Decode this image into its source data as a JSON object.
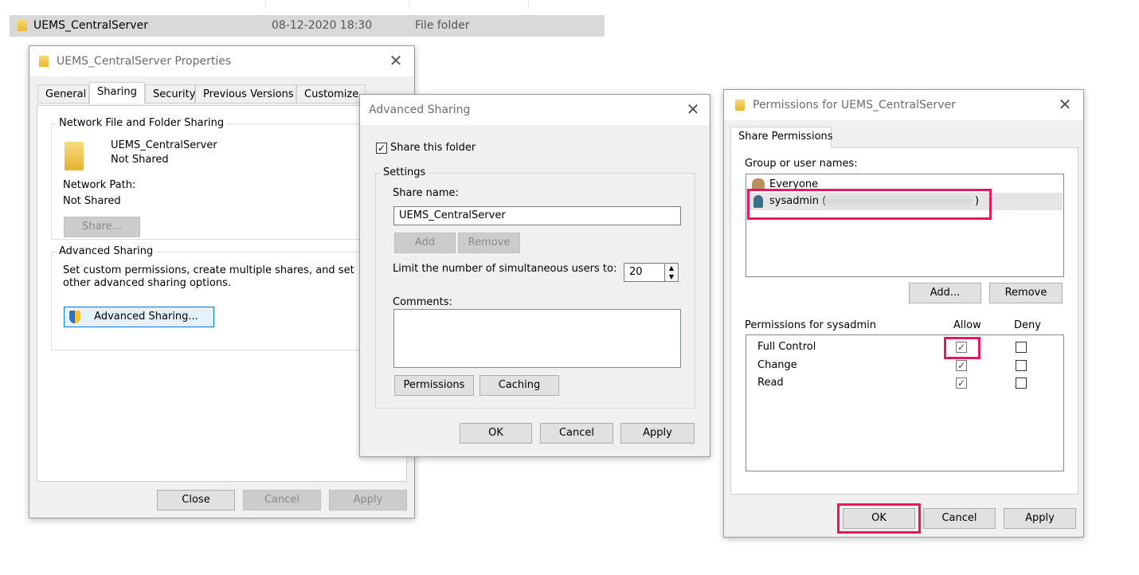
{
  "explorer": {
    "row": {
      "name": "UEMS_CentralServer",
      "date": "08-12-2020 18:30",
      "type": "File folder"
    }
  },
  "properties": {
    "title": "UEMS_CentralServer Properties",
    "close_glyph": "✕",
    "tabs": [
      {
        "label": "General"
      },
      {
        "label": "Sharing"
      },
      {
        "label": "Security"
      },
      {
        "label": "Previous Versions"
      },
      {
        "label": "Customize"
      }
    ],
    "network_group": {
      "legend": "Network File and Folder Sharing",
      "folder_name": "UEMS_CentralServer",
      "status": "Not Shared",
      "path_label": "Network Path:",
      "path_value": "Not Shared",
      "share_button": "Share..."
    },
    "advanced_group": {
      "legend": "Advanced Sharing",
      "description": "Set custom permissions, create multiple shares, and set other advanced sharing options.",
      "button": "Advanced Sharing..."
    },
    "buttons": {
      "close": "Close",
      "cancel": "Cancel",
      "apply": "Apply"
    }
  },
  "advanced_sharing": {
    "title": "Advanced Sharing",
    "close_glyph": "✕",
    "share_checkbox": {
      "label": "Share this folder",
      "checked": "✓"
    },
    "settings_legend": "Settings",
    "share_name_label": "Share name:",
    "share_name_value": "UEMS_CentralServer",
    "add_button": "Add",
    "remove_button": "Remove",
    "limit_label": "Limit the number of simultaneous users to:",
    "limit_value": "20",
    "comments_label": "Comments:",
    "permissions_button": "Permissions",
    "caching_button": "Caching",
    "buttons": {
      "ok": "OK",
      "cancel": "Cancel",
      "apply": "Apply"
    }
  },
  "permissions": {
    "title": "Permissions for UEMS_CentralServer",
    "close_glyph": "✕",
    "tab": "Share Permissions",
    "group_label": "Group or user names:",
    "users": [
      {
        "name": "Everyone"
      },
      {
        "name": "sysadmin (",
        "suffix": ")"
      }
    ],
    "add_button": "Add...",
    "remove_button": "Remove",
    "perm_label": "Permissions for sysadmin",
    "allow_header": "Allow",
    "deny_header": "Deny",
    "rows": [
      {
        "name": "Full Control",
        "allow": "✓",
        "deny": ""
      },
      {
        "name": "Change",
        "allow": "✓",
        "deny": ""
      },
      {
        "name": "Read",
        "allow": "✓",
        "deny": ""
      }
    ],
    "buttons": {
      "ok": "OK",
      "cancel": "Cancel",
      "apply": "Apply"
    },
    "highlight_color": "#e8175d"
  }
}
